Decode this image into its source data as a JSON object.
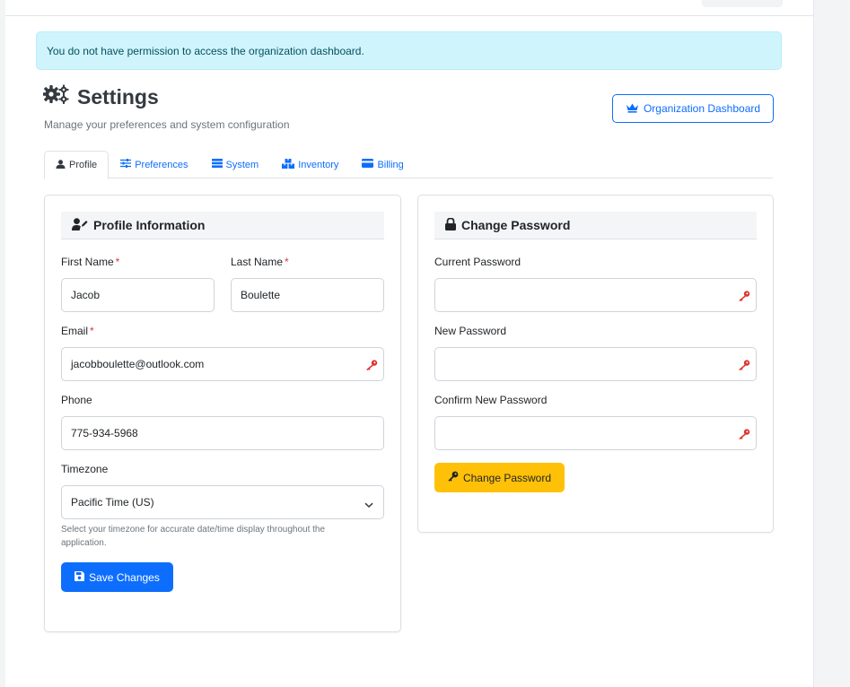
{
  "alert": {
    "message": "You do not have permission to access the organization dashboard."
  },
  "header": {
    "title": "Settings",
    "subtitle": "Manage your preferences and system configuration",
    "org_button_label": "Organization Dashboard"
  },
  "tabs": [
    {
      "label": "Profile",
      "icon": "user-icon",
      "active": true
    },
    {
      "label": "Preferences",
      "icon": "sliders-icon",
      "active": false
    },
    {
      "label": "System",
      "icon": "server-icon",
      "active": false
    },
    {
      "label": "Inventory",
      "icon": "boxes-icon",
      "active": false
    },
    {
      "label": "Billing",
      "icon": "credit-card-icon",
      "active": false
    }
  ],
  "profile": {
    "heading": "Profile Information",
    "first_name_label": "First Name",
    "first_name": "Jacob",
    "last_name_label": "Last Name",
    "last_name": "Boulette",
    "required_mark": "*",
    "email_label": "Email",
    "email": "jacobboulette@outlook.com",
    "phone_label": "Phone",
    "phone": "775-934-5968",
    "timezone_label": "Timezone",
    "timezone": "Pacific Time (US)",
    "timezone_help": "Select your timezone for accurate date/time display throughout the application.",
    "save_label": "Save Changes"
  },
  "password": {
    "heading": "Change Password",
    "current_label": "Current Password",
    "current_value": "",
    "new_label": "New Password",
    "new_value": "",
    "confirm_label": "Confirm New Password",
    "confirm_value": "",
    "button_label": "Change Password"
  },
  "colors": {
    "primary": "#0d6efd",
    "warning": "#ffc107",
    "alert_bg": "#cff4fc",
    "danger": "#dc3545"
  }
}
